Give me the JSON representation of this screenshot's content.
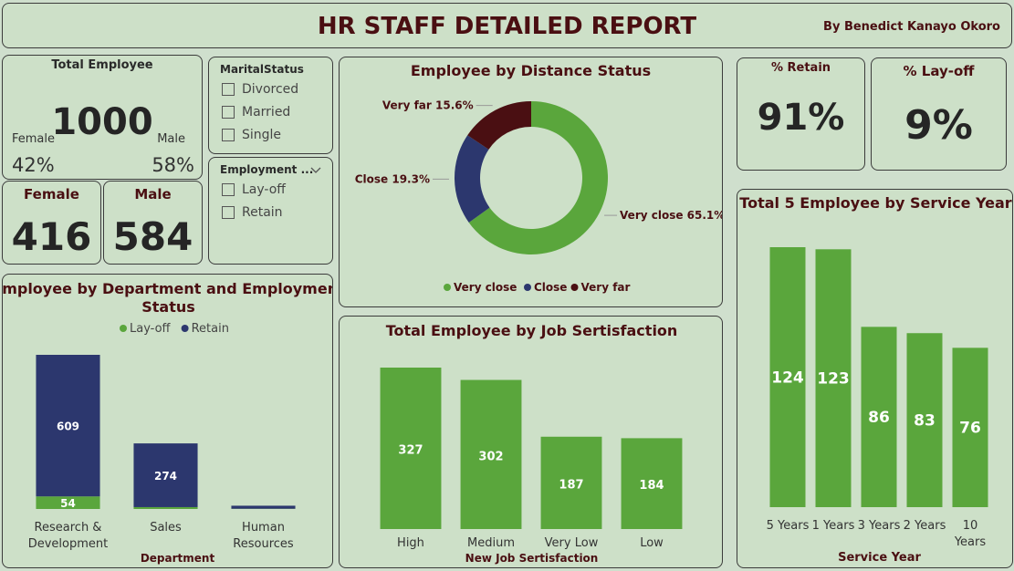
{
  "header": {
    "title": "HR STAFF DETAILED REPORT",
    "author": "By Benedict Kanayo Okoro"
  },
  "total_card": {
    "title": "Total Employee",
    "value": "1000",
    "female_label": "Female",
    "female_pct": "42%",
    "male_label": "Male",
    "male_pct": "58%"
  },
  "female_card": {
    "label": "Female",
    "value": "416"
  },
  "male_card": {
    "label": "Male",
    "value": "584"
  },
  "marital_slicer": {
    "title": "MaritalStatus",
    "options": [
      "Divorced",
      "Married",
      "Single"
    ]
  },
  "employment_slicer": {
    "title": "Employment ...",
    "options": [
      "Lay-off",
      "Retain"
    ]
  },
  "retain_card": {
    "label": "% Retain",
    "value": "91%"
  },
  "layoff_card": {
    "label": "% Lay-off",
    "value": "9%"
  },
  "colors": {
    "green": "#5aa63c",
    "navy": "#2c376e",
    "maroon": "#4a0f12"
  },
  "chart_data": [
    {
      "id": "distance",
      "type": "pie",
      "title": "Employee by Distance Status",
      "categories": [
        "Very close",
        "Close",
        "Very far"
      ],
      "values": [
        65.1,
        19.3,
        15.6
      ],
      "data_labels": [
        "Very close 65.1%",
        "Close 19.3%",
        "Very far 15.6%"
      ],
      "colors": [
        "#5aa63c",
        "#2c376e",
        "#4a0f12"
      ],
      "legend": "bottom"
    },
    {
      "id": "department",
      "type": "bar",
      "title": "Employee by Department and Employment Status",
      "xlabel": "Department",
      "categories": [
        "Research & Development",
        "Sales",
        "Human Resources"
      ],
      "category_lines": [
        [
          "Research &",
          "Development"
        ],
        [
          "Sales"
        ],
        [
          "Human",
          "Resources"
        ]
      ],
      "series": [
        {
          "name": "Lay-off",
          "values": [
            54,
            8,
            1
          ],
          "labels": [
            "54",
            "",
            ""
          ],
          "color": "#5aa63c"
        },
        {
          "name": "Retain",
          "values": [
            609,
            274,
            13
          ],
          "labels": [
            "609",
            "274",
            ""
          ],
          "color": "#2c376e"
        }
      ],
      "stacked": true,
      "legend": "top"
    },
    {
      "id": "satisfaction",
      "type": "bar",
      "title": "Total Employee by Job Sertisfaction",
      "xlabel": "New Job Sertisfaction",
      "categories": [
        "High",
        "Medium",
        "Very Low",
        "Low"
      ],
      "values": [
        327,
        302,
        187,
        184
      ],
      "color": "#5aa63c"
    },
    {
      "id": "service",
      "type": "bar",
      "title": "Total 5 Employee by Service Year",
      "xlabel": "Service Year",
      "categories": [
        "5 Years",
        "1 Years",
        "3 Years",
        "2 Years",
        "10 Years"
      ],
      "category_lines": [
        [
          "5 Years"
        ],
        [
          "1 Years"
        ],
        [
          "3 Years"
        ],
        [
          "2 Years"
        ],
        [
          "10",
          "Years"
        ]
      ],
      "values": [
        124,
        123,
        86,
        83,
        76
      ],
      "color": "#5aa63c"
    }
  ]
}
